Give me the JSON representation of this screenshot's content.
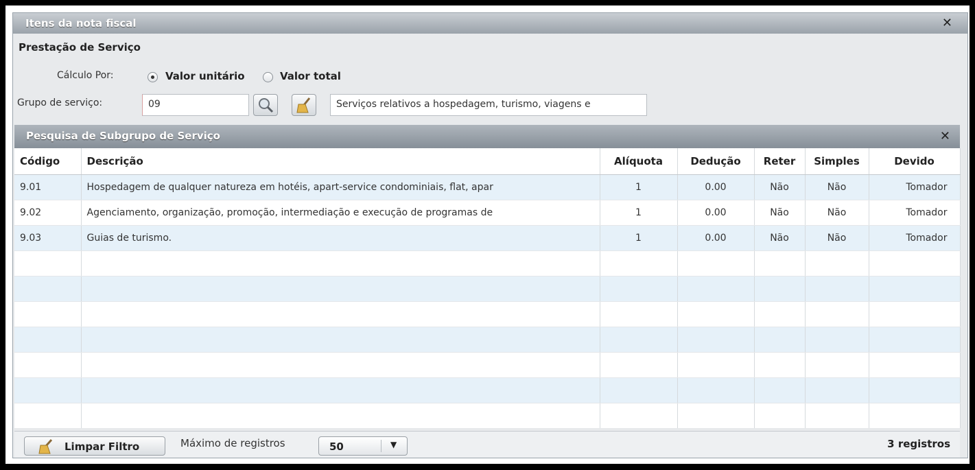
{
  "outer": {
    "title": "Itens da nota fiscal",
    "section": "Prestação de Serviço",
    "calc_label": "Cálculo Por:",
    "radio_unit": "Valor unitário",
    "radio_total": "Valor total",
    "grupo_label": "Grupo de serviço:",
    "grupo_code": "09",
    "grupo_desc": "Serviços relativos a hospedagem, turismo, viagens e",
    "close": "✕"
  },
  "dialog": {
    "title": "Pesquisa de Subgrupo de Serviço",
    "close": "✕",
    "headers": [
      "Código",
      "Descrição",
      "Alíquota",
      "Dedução",
      "Reter",
      "Simples",
      "Devido"
    ],
    "rows": [
      {
        "codigo": "9.01",
        "descricao": "Hospedagem de qualquer natureza em hotéis, apart-service condominiais, flat, apar",
        "aliquota": "1",
        "deducao": "0.00",
        "reter": "Não",
        "simples": "Não",
        "devido": "Tomador"
      },
      {
        "codigo": "9.02",
        "descricao": "Agenciamento, organização, promoção, intermediação e execução de programas de",
        "aliquota": "1",
        "deducao": "0.00",
        "reter": "Não",
        "simples": "Não",
        "devido": "Tomador"
      },
      {
        "codigo": "9.03",
        "descricao": "Guias de turismo.",
        "aliquota": "1",
        "deducao": "0.00",
        "reter": "Não",
        "simples": "Não",
        "devido": "Tomador"
      }
    ]
  },
  "footer": {
    "limpar_label": "Limpar Filtro",
    "max_label": "Máximo de registros",
    "max_value": "50",
    "count": "3 registros"
  },
  "icons": {
    "search": "magnifier-icon",
    "broom": "broom-icon",
    "dropdown": "chevron-down-icon"
  }
}
